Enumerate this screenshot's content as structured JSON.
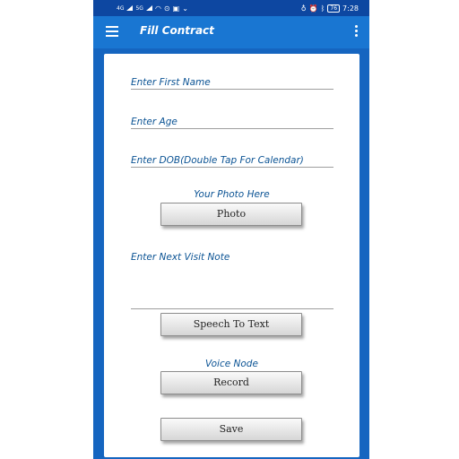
{
  "status_bar": {
    "left_text": "4G",
    "extra": "5G",
    "battery": "76",
    "time": "7:28"
  },
  "app_bar": {
    "title": "Fill Contract"
  },
  "form": {
    "first_name_placeholder": "Enter First Name",
    "age_placeholder": "Enter Age",
    "dob_placeholder": "Enter DOB(Double Tap For Calendar)",
    "photo_label": "Your Photo Here",
    "photo_button": "Photo",
    "visit_note_placeholder": "Enter Next Visit Note",
    "speech_button": "Speech To Text",
    "voice_label": "Voice Node",
    "record_button": "Record",
    "save_button": "Save"
  },
  "colors": {
    "app_bar": "#1976d2",
    "status_bar": "#0d47a1",
    "background": "#1565c0",
    "label_text": "#0b5394"
  }
}
